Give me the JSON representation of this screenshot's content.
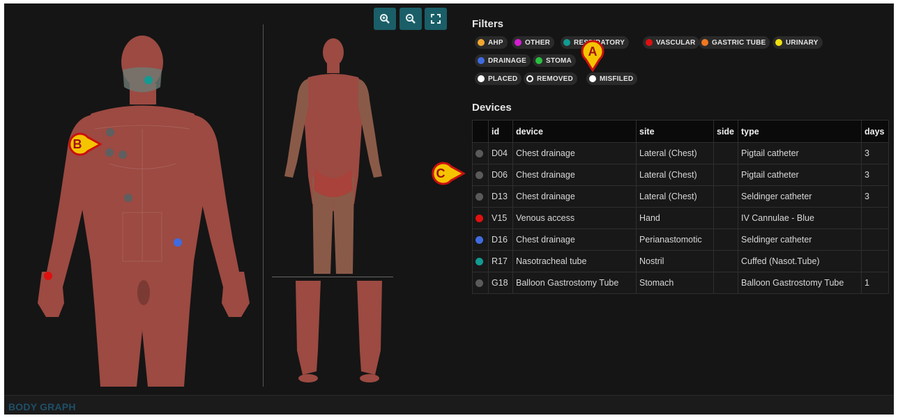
{
  "footer": {
    "title": "BODY GRAPH"
  },
  "toolbar": {
    "zoom_in_icon": "zoom-in-icon",
    "zoom_out_icon": "zoom-out-icon",
    "fit_icon": "fullscreen-icon"
  },
  "filters": {
    "title": "Filters",
    "chips": [
      {
        "label": "AHP",
        "color": "#f0a830"
      },
      {
        "label": "OTHER",
        "color": "#d41ed4"
      },
      {
        "label": "RESPIRATORY",
        "color": "#139a92"
      },
      {
        "label": "VASCULAR",
        "color": "#dd1111"
      },
      {
        "label": "GASTRIC TUBE",
        "color": "#f07820"
      },
      {
        "label": "URINARY",
        "color": "#f0e010"
      },
      {
        "label": "DRAINAGE",
        "color": "#3f6be0"
      },
      {
        "label": "STOMA",
        "color": "#28c040"
      },
      {
        "label": "PLACED",
        "color": "#ffffff"
      },
      {
        "label": "REMOVED",
        "color": "none"
      },
      {
        "label": "MISFILED",
        "color": "#ffffff"
      }
    ]
  },
  "devices": {
    "title": "Devices",
    "columns": [
      "",
      "id",
      "device",
      "site",
      "side",
      "type",
      "days"
    ],
    "rows": [
      {
        "color": "#5a5a5a",
        "id": "D04",
        "device": "Chest drainage",
        "site": "Lateral (Chest)",
        "side": "",
        "type": "Pigtail catheter",
        "days": "3"
      },
      {
        "color": "#5a5a5a",
        "id": "D06",
        "device": "Chest drainage",
        "site": "Lateral (Chest)",
        "side": "",
        "type": "Pigtail catheter",
        "days": "3"
      },
      {
        "color": "#5a5a5a",
        "id": "D13",
        "device": "Chest drainage",
        "site": "Lateral (Chest)",
        "side": "",
        "type": "Seldinger catheter",
        "days": "3"
      },
      {
        "color": "#e01010",
        "id": "V15",
        "device": "Venous access",
        "site": "Hand",
        "side": "",
        "type": "IV Cannulae - Blue",
        "days": ""
      },
      {
        "color": "#3f6be0",
        "id": "D16",
        "device": "Chest drainage",
        "site": "Perianastomotic",
        "side": "",
        "type": "Seldinger catheter",
        "days": ""
      },
      {
        "color": "#139a92",
        "id": "R17",
        "device": "Nasotracheal tube",
        "site": "Nostril",
        "side": "",
        "type": "Cuffed (Nasot.Tube)",
        "days": ""
      },
      {
        "color": "#5a5a5a",
        "id": "G18",
        "device": "Balloon Gastrostomy Tube",
        "site": "Stomach",
        "side": "",
        "type": "Balloon Gastrostomy Tube",
        "days": "1"
      }
    ]
  },
  "body_markers": [
    {
      "name": "nostril-device-dot",
      "color": "#139a92"
    },
    {
      "name": "chest-device-dot-1",
      "color": "#5f5f5f"
    },
    {
      "name": "chest-device-dot-2",
      "color": "#5f5f5f"
    },
    {
      "name": "chest-device-dot-3",
      "color": "#5f5f5f"
    },
    {
      "name": "stomach-device-dot",
      "color": "#5f5f5f"
    },
    {
      "name": "abdomen-drainage-dot",
      "color": "#3f6be0"
    },
    {
      "name": "hand-venous-dot",
      "color": "#e01010"
    }
  ],
  "callouts": [
    {
      "label": "A"
    },
    {
      "label": "B"
    },
    {
      "label": "C"
    }
  ],
  "colors": {
    "skin": "#9c4a42",
    "accent_button": "#1a5e68",
    "callout_fill": "#f5c400",
    "callout_border": "#c81010"
  }
}
